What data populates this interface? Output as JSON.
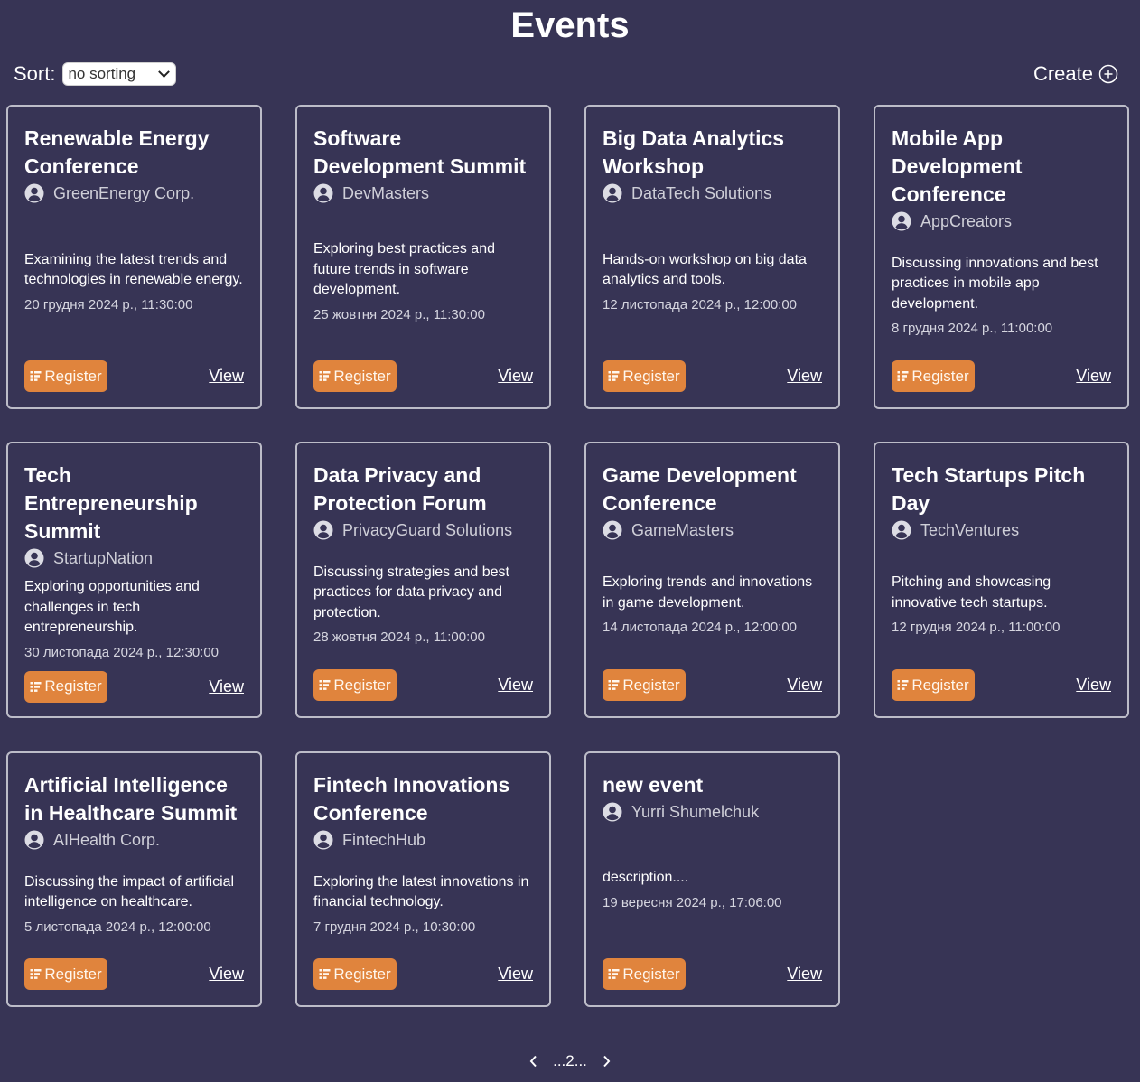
{
  "header": {
    "title": "Events",
    "sort_label": "Sort:",
    "sort_value": "no sorting",
    "create_label": "Create"
  },
  "events": [
    {
      "title": "Renewable Energy Conference",
      "organizer": "GreenEnergy Corp.",
      "description": "Examining the latest trends and technologies in renewable energy.",
      "date": "20 грудня 2024 р., 11:30:00",
      "register_label": "Register",
      "view_label": "View"
    },
    {
      "title": "Software Development Summit",
      "organizer": "DevMasters",
      "description": "Exploring best practices and future trends in software development.",
      "date": "25 жовтня 2024 р., 11:30:00",
      "register_label": "Register",
      "view_label": "View"
    },
    {
      "title": "Big Data Analytics Workshop",
      "organizer": "DataTech Solutions",
      "description": "Hands-on workshop on big data analytics and tools.",
      "date": "12 листопада 2024 р., 12:00:00",
      "register_label": "Register",
      "view_label": "View"
    },
    {
      "title": "Mobile App Development Conference",
      "organizer": "AppCreators",
      "description": "Discussing innovations and best practices in mobile app development.",
      "date": "8 грудня 2024 р., 11:00:00",
      "register_label": "Register",
      "view_label": "View"
    },
    {
      "title": "Tech Entrepreneurship Summit",
      "organizer": "StartupNation",
      "description": "Exploring opportunities and challenges in tech entrepreneurship.",
      "date": "30 листопада 2024 р., 12:30:00",
      "register_label": "Register",
      "view_label": "View"
    },
    {
      "title": "Data Privacy and Protection Forum",
      "organizer": "PrivacyGuard Solutions",
      "description": "Discussing strategies and best practices for data privacy and protection.",
      "date": "28 жовтня 2024 р., 11:00:00",
      "register_label": "Register",
      "view_label": "View"
    },
    {
      "title": "Game Development Conference",
      "organizer": "GameMasters",
      "description": "Exploring trends and innovations in game development.",
      "date": "14 листопада 2024 р., 12:00:00",
      "register_label": "Register",
      "view_label": "View"
    },
    {
      "title": "Tech Startups Pitch Day",
      "organizer": "TechVentures",
      "description": "Pitching and showcasing innovative tech startups.",
      "date": "12 грудня 2024 р., 11:00:00",
      "register_label": "Register",
      "view_label": "View"
    },
    {
      "title": "Artificial Intelligence in Healthcare Summit",
      "organizer": "AIHealth Corp.",
      "description": "Discussing the impact of artificial intelligence on healthcare.",
      "date": "5 листопада 2024 р., 12:00:00",
      "register_label": "Register",
      "view_label": "View"
    },
    {
      "title": "Fintech Innovations Conference",
      "organizer": "FintechHub",
      "description": "Exploring the latest innovations in financial technology.",
      "date": "7 грудня 2024 р., 10:30:00",
      "register_label": "Register",
      "view_label": "View"
    },
    {
      "title": "new event",
      "organizer": "Yurri Shumelchuk",
      "description": "description....",
      "date": "19 вересня 2024 р., 17:06:00",
      "register_label": "Register",
      "view_label": "View"
    }
  ],
  "pagination": {
    "label": "...2...",
    "prev_icon": "chevron-left-icon",
    "next_icon": "chevron-right-icon"
  },
  "colors": {
    "background": "#373455",
    "accent": "#e0843d",
    "card_border": "#bcbcc8"
  }
}
